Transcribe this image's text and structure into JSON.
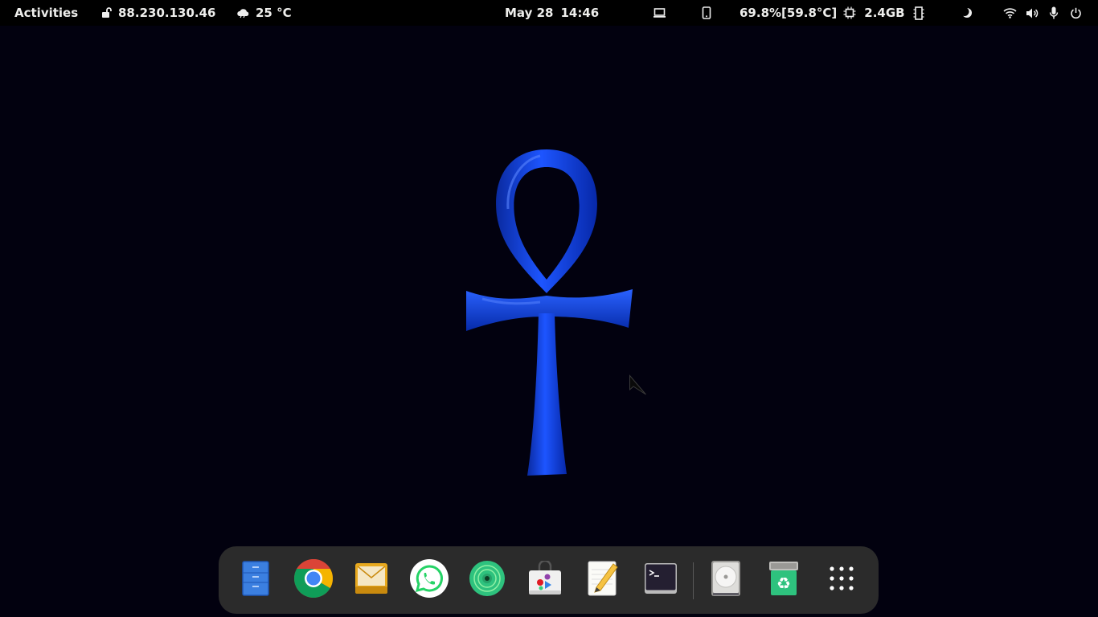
{
  "topbar": {
    "activities_label": "Activities",
    "ip_address": "88.230.130.46",
    "weather": "25 °C",
    "clock_date": "May 28",
    "clock_time": "14:46",
    "cpu_usage": "69.8%[59.8°C]",
    "memory": "2.4GB"
  },
  "icons": {
    "lock": "unlocked-padlock-icon",
    "weather": "cloudy-weather-icon",
    "laptop": "laptop-icon",
    "phone": "phone-icon",
    "cpu": "cpu-chip-icon",
    "memory": "memory-icon",
    "night_light": "night-light-icon",
    "wifi": "wifi-icon",
    "volume": "volume-icon",
    "microphone": "microphone-icon",
    "power": "power-icon"
  },
  "dock": {
    "items": [
      {
        "name": "files"
      },
      {
        "name": "google-chrome"
      },
      {
        "name": "mail"
      },
      {
        "name": "whatsapp"
      },
      {
        "name": "music-player"
      },
      {
        "name": "software-store"
      },
      {
        "name": "text-editor"
      },
      {
        "name": "terminal"
      },
      {
        "name": "disk"
      },
      {
        "name": "trash"
      },
      {
        "name": "show-applications"
      }
    ]
  },
  "colors": {
    "topbar_bg": "#000000",
    "desktop_bg": "#02010f",
    "dock_bg": "#2b2b2b",
    "ankh_blue": "#0b3ec9"
  }
}
